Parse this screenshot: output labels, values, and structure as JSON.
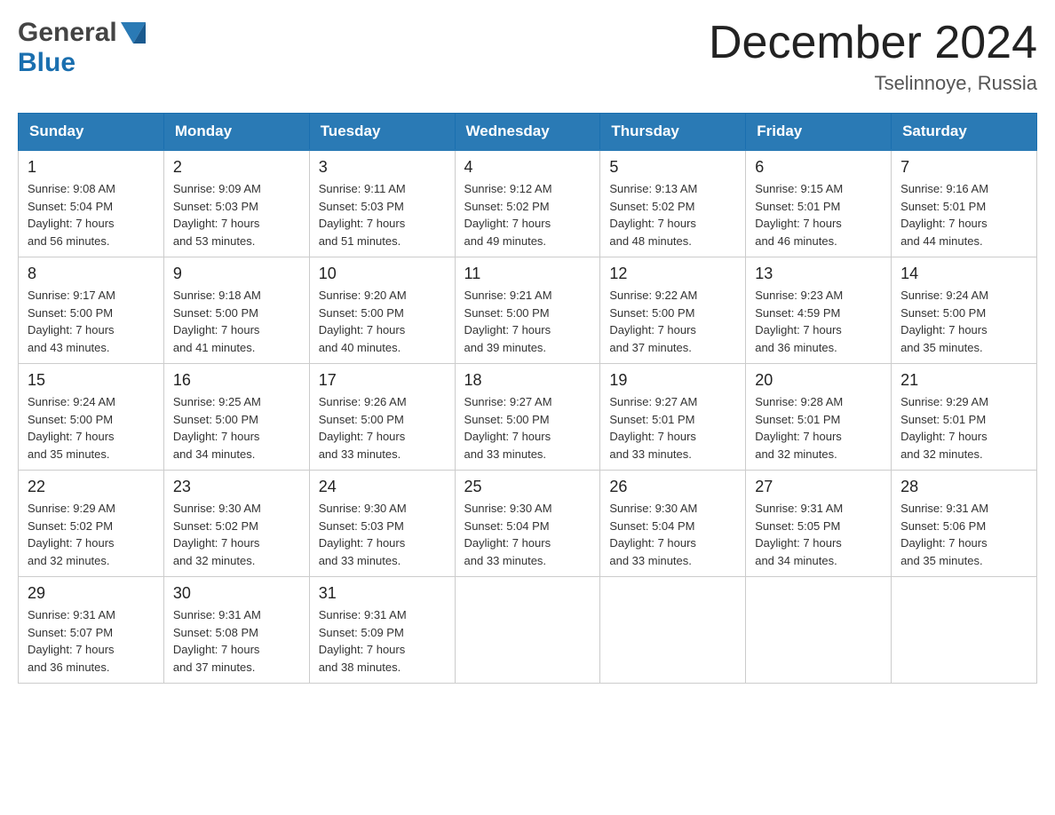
{
  "header": {
    "logo_general": "General",
    "logo_blue": "Blue",
    "title": "December 2024",
    "subtitle": "Tselinnoye, Russia"
  },
  "weekdays": [
    "Sunday",
    "Monday",
    "Tuesday",
    "Wednesday",
    "Thursday",
    "Friday",
    "Saturday"
  ],
  "weeks": [
    [
      {
        "day": "1",
        "sunrise": "9:08 AM",
        "sunset": "5:04 PM",
        "daylight": "7 hours and 56 minutes."
      },
      {
        "day": "2",
        "sunrise": "9:09 AM",
        "sunset": "5:03 PM",
        "daylight": "7 hours and 53 minutes."
      },
      {
        "day": "3",
        "sunrise": "9:11 AM",
        "sunset": "5:03 PM",
        "daylight": "7 hours and 51 minutes."
      },
      {
        "day": "4",
        "sunrise": "9:12 AM",
        "sunset": "5:02 PM",
        "daylight": "7 hours and 49 minutes."
      },
      {
        "day": "5",
        "sunrise": "9:13 AM",
        "sunset": "5:02 PM",
        "daylight": "7 hours and 48 minutes."
      },
      {
        "day": "6",
        "sunrise": "9:15 AM",
        "sunset": "5:01 PM",
        "daylight": "7 hours and 46 minutes."
      },
      {
        "day": "7",
        "sunrise": "9:16 AM",
        "sunset": "5:01 PM",
        "daylight": "7 hours and 44 minutes."
      }
    ],
    [
      {
        "day": "8",
        "sunrise": "9:17 AM",
        "sunset": "5:00 PM",
        "daylight": "7 hours and 43 minutes."
      },
      {
        "day": "9",
        "sunrise": "9:18 AM",
        "sunset": "5:00 PM",
        "daylight": "7 hours and 41 minutes."
      },
      {
        "day": "10",
        "sunrise": "9:20 AM",
        "sunset": "5:00 PM",
        "daylight": "7 hours and 40 minutes."
      },
      {
        "day": "11",
        "sunrise": "9:21 AM",
        "sunset": "5:00 PM",
        "daylight": "7 hours and 39 minutes."
      },
      {
        "day": "12",
        "sunrise": "9:22 AM",
        "sunset": "5:00 PM",
        "daylight": "7 hours and 37 minutes."
      },
      {
        "day": "13",
        "sunrise": "9:23 AM",
        "sunset": "4:59 PM",
        "daylight": "7 hours and 36 minutes."
      },
      {
        "day": "14",
        "sunrise": "9:24 AM",
        "sunset": "5:00 PM",
        "daylight": "7 hours and 35 minutes."
      }
    ],
    [
      {
        "day": "15",
        "sunrise": "9:24 AM",
        "sunset": "5:00 PM",
        "daylight": "7 hours and 35 minutes."
      },
      {
        "day": "16",
        "sunrise": "9:25 AM",
        "sunset": "5:00 PM",
        "daylight": "7 hours and 34 minutes."
      },
      {
        "day": "17",
        "sunrise": "9:26 AM",
        "sunset": "5:00 PM",
        "daylight": "7 hours and 33 minutes."
      },
      {
        "day": "18",
        "sunrise": "9:27 AM",
        "sunset": "5:00 PM",
        "daylight": "7 hours and 33 minutes."
      },
      {
        "day": "19",
        "sunrise": "9:27 AM",
        "sunset": "5:01 PM",
        "daylight": "7 hours and 33 minutes."
      },
      {
        "day": "20",
        "sunrise": "9:28 AM",
        "sunset": "5:01 PM",
        "daylight": "7 hours and 32 minutes."
      },
      {
        "day": "21",
        "sunrise": "9:29 AM",
        "sunset": "5:01 PM",
        "daylight": "7 hours and 32 minutes."
      }
    ],
    [
      {
        "day": "22",
        "sunrise": "9:29 AM",
        "sunset": "5:02 PM",
        "daylight": "7 hours and 32 minutes."
      },
      {
        "day": "23",
        "sunrise": "9:30 AM",
        "sunset": "5:02 PM",
        "daylight": "7 hours and 32 minutes."
      },
      {
        "day": "24",
        "sunrise": "9:30 AM",
        "sunset": "5:03 PM",
        "daylight": "7 hours and 33 minutes."
      },
      {
        "day": "25",
        "sunrise": "9:30 AM",
        "sunset": "5:04 PM",
        "daylight": "7 hours and 33 minutes."
      },
      {
        "day": "26",
        "sunrise": "9:30 AM",
        "sunset": "5:04 PM",
        "daylight": "7 hours and 33 minutes."
      },
      {
        "day": "27",
        "sunrise": "9:31 AM",
        "sunset": "5:05 PM",
        "daylight": "7 hours and 34 minutes."
      },
      {
        "day": "28",
        "sunrise": "9:31 AM",
        "sunset": "5:06 PM",
        "daylight": "7 hours and 35 minutes."
      }
    ],
    [
      {
        "day": "29",
        "sunrise": "9:31 AM",
        "sunset": "5:07 PM",
        "daylight": "7 hours and 36 minutes."
      },
      {
        "day": "30",
        "sunrise": "9:31 AM",
        "sunset": "5:08 PM",
        "daylight": "7 hours and 37 minutes."
      },
      {
        "day": "31",
        "sunrise": "9:31 AM",
        "sunset": "5:09 PM",
        "daylight": "7 hours and 38 minutes."
      },
      null,
      null,
      null,
      null
    ]
  ]
}
